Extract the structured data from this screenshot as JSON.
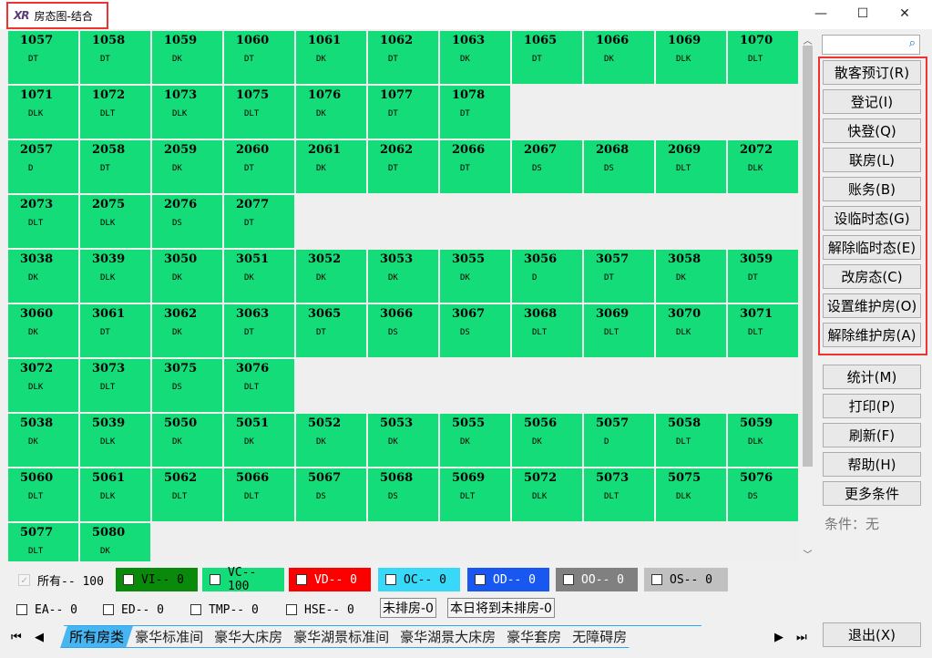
{
  "window": {
    "logo": "XR",
    "title": "房态图-结合",
    "minimize": "—",
    "maximize": "☐",
    "close": "✕"
  },
  "rooms": [
    [
      {
        "n": "1057",
        "t": "DT"
      },
      {
        "n": "1058",
        "t": "DT"
      },
      {
        "n": "1059",
        "t": "DK"
      },
      {
        "n": "1060",
        "t": "DT"
      },
      {
        "n": "1061",
        "t": "DK"
      },
      {
        "n": "1062",
        "t": "DT"
      },
      {
        "n": "1063",
        "t": "DK"
      },
      {
        "n": "1065",
        "t": "DT"
      },
      {
        "n": "1066",
        "t": "DK"
      },
      {
        "n": "1069",
        "t": "DLK"
      },
      {
        "n": "1070",
        "t": "DLT"
      }
    ],
    [
      {
        "n": "1071",
        "t": "DLK"
      },
      {
        "n": "1072",
        "t": "DLT"
      },
      {
        "n": "1073",
        "t": "DLK"
      },
      {
        "n": "1075",
        "t": "DLT"
      },
      {
        "n": "1076",
        "t": "DK"
      },
      {
        "n": "1077",
        "t": "DT"
      },
      {
        "n": "1078",
        "t": "DT"
      }
    ],
    [
      {
        "n": "2057",
        "t": "D"
      },
      {
        "n": "2058",
        "t": "DT"
      },
      {
        "n": "2059",
        "t": "DK"
      },
      {
        "n": "2060",
        "t": "DT"
      },
      {
        "n": "2061",
        "t": "DK"
      },
      {
        "n": "2062",
        "t": "DT"
      },
      {
        "n": "2066",
        "t": "DT"
      },
      {
        "n": "2067",
        "t": "DS"
      },
      {
        "n": "2068",
        "t": "DS"
      },
      {
        "n": "2069",
        "t": "DLT"
      },
      {
        "n": "2072",
        "t": "DLK"
      }
    ],
    [
      {
        "n": "2073",
        "t": "DLT"
      },
      {
        "n": "2075",
        "t": "DLK"
      },
      {
        "n": "2076",
        "t": "DS"
      },
      {
        "n": "2077",
        "t": "DT"
      }
    ],
    [
      {
        "n": "3038",
        "t": "DK"
      },
      {
        "n": "3039",
        "t": "DLK"
      },
      {
        "n": "3050",
        "t": "DK"
      },
      {
        "n": "3051",
        "t": "DK"
      },
      {
        "n": "3052",
        "t": "DK"
      },
      {
        "n": "3053",
        "t": "DK"
      },
      {
        "n": "3055",
        "t": "DK"
      },
      {
        "n": "3056",
        "t": "D"
      },
      {
        "n": "3057",
        "t": "DT"
      },
      {
        "n": "3058",
        "t": "DK"
      },
      {
        "n": "3059",
        "t": "DT"
      }
    ],
    [
      {
        "n": "3060",
        "t": "DK"
      },
      {
        "n": "3061",
        "t": "DT"
      },
      {
        "n": "3062",
        "t": "DK"
      },
      {
        "n": "3063",
        "t": "DT"
      },
      {
        "n": "3065",
        "t": "DT"
      },
      {
        "n": "3066",
        "t": "DS"
      },
      {
        "n": "3067",
        "t": "DS"
      },
      {
        "n": "3068",
        "t": "DLT"
      },
      {
        "n": "3069",
        "t": "DLT"
      },
      {
        "n": "3070",
        "t": "DLK"
      },
      {
        "n": "3071",
        "t": "DLT"
      }
    ],
    [
      {
        "n": "3072",
        "t": "DLK"
      },
      {
        "n": "3073",
        "t": "DLT"
      },
      {
        "n": "3075",
        "t": "DS"
      },
      {
        "n": "3076",
        "t": "DLT"
      }
    ],
    [
      {
        "n": "5038",
        "t": "DK"
      },
      {
        "n": "5039",
        "t": "DLK"
      },
      {
        "n": "5050",
        "t": "DK"
      },
      {
        "n": "5051",
        "t": "DK"
      },
      {
        "n": "5052",
        "t": "DK"
      },
      {
        "n": "5053",
        "t": "DK"
      },
      {
        "n": "5055",
        "t": "DK"
      },
      {
        "n": "5056",
        "t": "DK"
      },
      {
        "n": "5057",
        "t": "D"
      },
      {
        "n": "5058",
        "t": "DLT"
      },
      {
        "n": "5059",
        "t": "DLK"
      }
    ],
    [
      {
        "n": "5060",
        "t": "DLT"
      },
      {
        "n": "5061",
        "t": "DLK"
      },
      {
        "n": "5062",
        "t": "DLT"
      },
      {
        "n": "5066",
        "t": "DLT"
      },
      {
        "n": "5067",
        "t": "DS"
      },
      {
        "n": "5068",
        "t": "DS"
      },
      {
        "n": "5069",
        "t": "DLT"
      },
      {
        "n": "5072",
        "t": "DLK"
      },
      {
        "n": "5073",
        "t": "DLT"
      },
      {
        "n": "5075",
        "t": "DLK"
      },
      {
        "n": "5076",
        "t": "DS"
      }
    ],
    [
      {
        "n": "5077",
        "t": "DLT"
      },
      {
        "n": "5080",
        "t": "DK"
      }
    ]
  ],
  "room_color": "#14dc78",
  "search": {
    "icon": "search-icon",
    "value": ""
  },
  "buttons": [
    "散客预订(R)",
    "登记(I)",
    "快登(Q)",
    "联房(L)",
    "账务(B)",
    "设临时态(G)",
    "解除临时态(E)",
    "改房态(C)",
    "设置维护房(O)",
    "解除维护房(A)"
  ],
  "buttons2": [
    "统计(M)",
    "打印(P)",
    "刷新(F)",
    "帮助(H)",
    "更多条件"
  ],
  "condition": "条件：无",
  "legend1": [
    {
      "label": "所有-- 100",
      "bg": "#f0f0f0",
      "fg": "#000",
      "checked": true
    },
    {
      "label": "VI-- 0",
      "bg": "#0a8a0a",
      "fg": "#000",
      "checked": false
    },
    {
      "label": "VC-- 100",
      "bg": "#14dc78",
      "fg": "#000",
      "checked": false
    },
    {
      "label": "VD-- 0",
      "bg": "#fc0000",
      "fg": "#fff",
      "checked": false
    },
    {
      "label": "OC-- 0",
      "bg": "#38d8f8",
      "fg": "#000",
      "checked": false
    },
    {
      "label": "OD-- 0",
      "bg": "#1858f0",
      "fg": "#fff",
      "checked": false
    },
    {
      "label": "OO-- 0",
      "bg": "#808080",
      "fg": "#fff",
      "checked": false
    },
    {
      "label": "OS-- 0",
      "bg": "#c0c0c0",
      "fg": "#000",
      "checked": false
    }
  ],
  "legend2": [
    {
      "label": "EA-- 0"
    },
    {
      "label": "ED-- 0"
    },
    {
      "label": "TMP-- 0"
    },
    {
      "label": "HSE-- 0"
    }
  ],
  "pills": [
    "未排房-0",
    "本日将到未排房-0"
  ],
  "tabs": [
    "所有房类",
    "豪华标准间",
    "豪华大床房",
    "豪华湖景标准间",
    "豪华湖景大床房",
    "豪华套房",
    "无障碍房"
  ],
  "nav": {
    "first": "⏮",
    "prev": "◀",
    "next": "▶",
    "last": "⏭"
  },
  "exit": "退出(X)"
}
